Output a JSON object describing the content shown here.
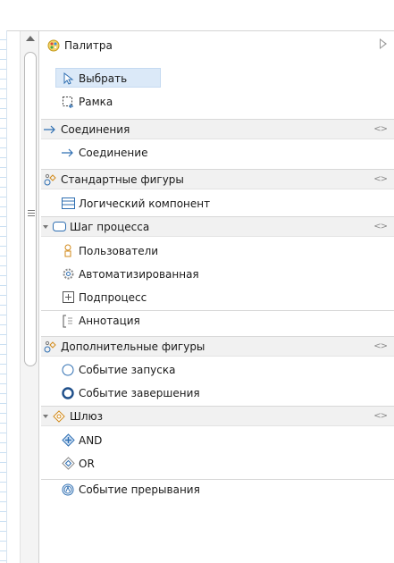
{
  "palette": {
    "title": "Палитра",
    "tools": {
      "select": "Выбрать",
      "marquee": "Рамка"
    },
    "connections": {
      "drawer": "Соединения",
      "item": "Соединение"
    },
    "standard": {
      "drawer": "Стандартные фигуры",
      "logical_component": "Логический компонент",
      "process_step": "Шаг процесса",
      "users": "Пользователи",
      "automated": "Автоматизированная",
      "subprocess": "Подпроцесс",
      "annotation": "Аннотация"
    },
    "additional": {
      "drawer": "Дополнительные фигуры",
      "start_event": "Событие запуска",
      "end_event": "Событие завершения",
      "gateway": "Шлюз",
      "and": "AND",
      "or": "OR",
      "interrupt_event": "Событие прерывания"
    }
  },
  "colors": {
    "selection": "#dbe9f8",
    "drawer_bg": "#f1f1f1",
    "accent_blue": "#2f6fb2"
  }
}
